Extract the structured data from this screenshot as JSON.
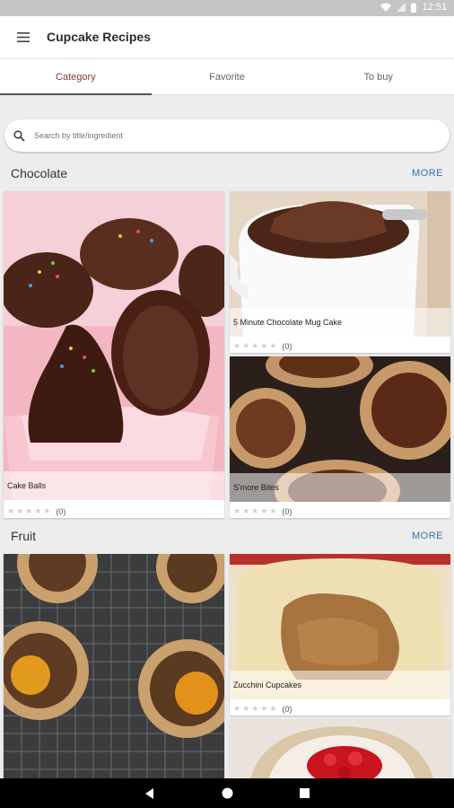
{
  "status": {
    "time": "12:51"
  },
  "appbar": {
    "title": "Cupcake Recipes",
    "menu_icon": "hamburger-icon"
  },
  "tabs": [
    {
      "label": "Category",
      "active": true
    },
    {
      "label": "Favorite",
      "active": false
    },
    {
      "label": "To buy",
      "active": false
    }
  ],
  "search": {
    "placeholder": "Search by title/ingredient"
  },
  "sections": [
    {
      "title": "Chocolate",
      "more_label": "MORE",
      "recipes": [
        {
          "name": "Cake Balls",
          "rating_count": "(0)"
        },
        {
          "name": "5 Minute Chocolate Mug Cake",
          "rating_count": "(0)"
        },
        {
          "name": "S'more Bites",
          "rating_count": "(0)"
        }
      ]
    },
    {
      "title": "Fruit",
      "more_label": "MORE",
      "recipes": [
        {
          "name": "",
          "rating_count": ""
        },
        {
          "name": "Zucchini Cupcakes",
          "rating_count": "(0)"
        },
        {
          "name": "",
          "rating_count": ""
        }
      ]
    }
  ],
  "colors": {
    "active_tab": "#8a3a3a",
    "more_link": "#3a6fb0",
    "star_empty": "#cfcfcf"
  }
}
